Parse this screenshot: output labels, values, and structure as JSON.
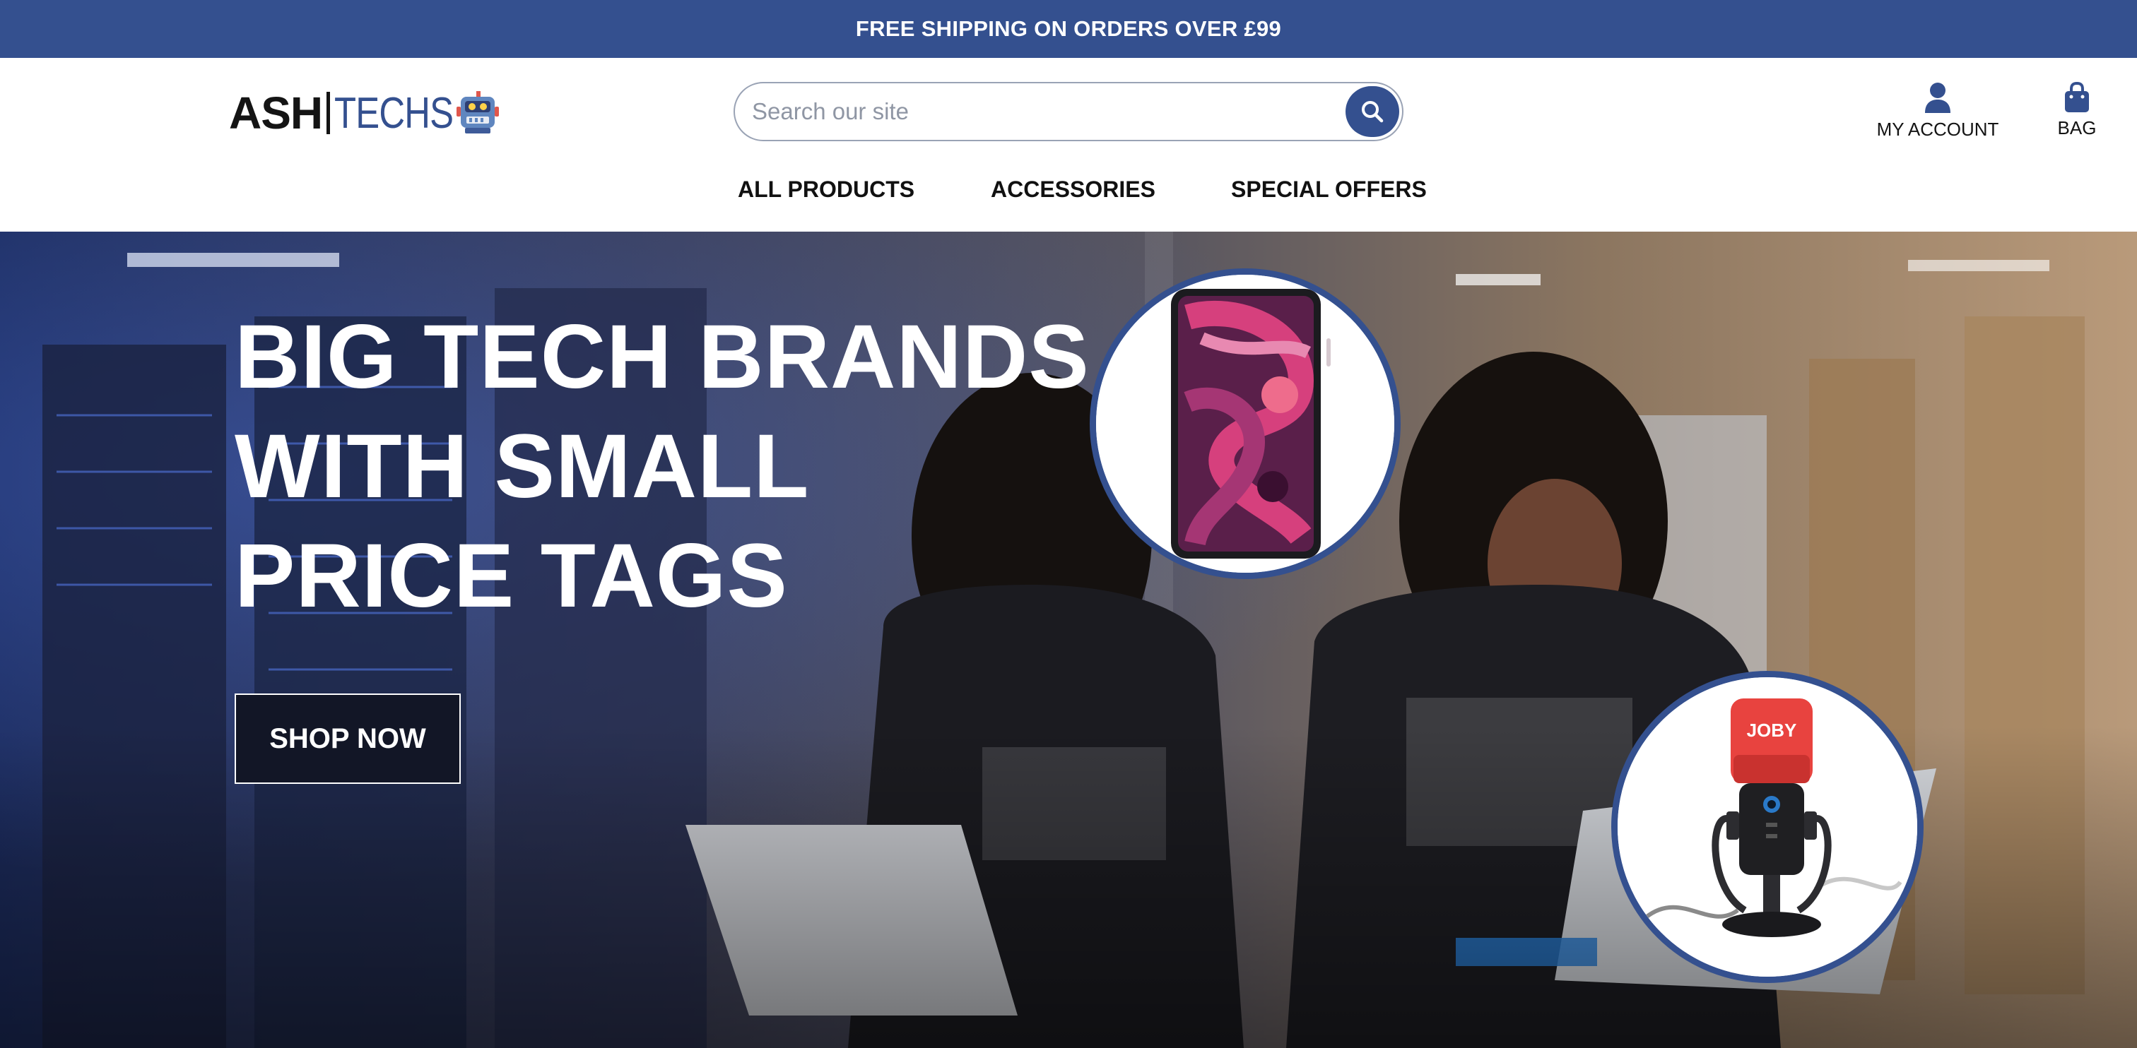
{
  "promo": {
    "text": "FREE SHIPPING ON ORDERS OVER £99"
  },
  "header": {
    "logo": {
      "part1": "ASH",
      "part2": "TECHS"
    },
    "search": {
      "placeholder": "Search our site",
      "value": ""
    },
    "account_label": "MY ACCOUNT",
    "bag_label": "BAG"
  },
  "nav": {
    "items": [
      {
        "label": "ALL PRODUCTS"
      },
      {
        "label": "ACCESSORIES"
      },
      {
        "label": "SPECIAL OFFERS"
      }
    ]
  },
  "hero": {
    "heading_lines": [
      "BIG TECH BRANDS",
      "WITH SMALL",
      "PRICE TAGS"
    ],
    "cta_label": "SHOP NOW",
    "products": [
      {
        "name": "ipad",
        "icon": "tablet-product-image"
      },
      {
        "name": "microphone",
        "brand_text": "JOBY",
        "icon": "microphone-product-image"
      }
    ]
  },
  "colors": {
    "brand_blue": "#34508f",
    "dark_button": "#121626",
    "text_dark": "#141414",
    "white": "#ffffff"
  }
}
